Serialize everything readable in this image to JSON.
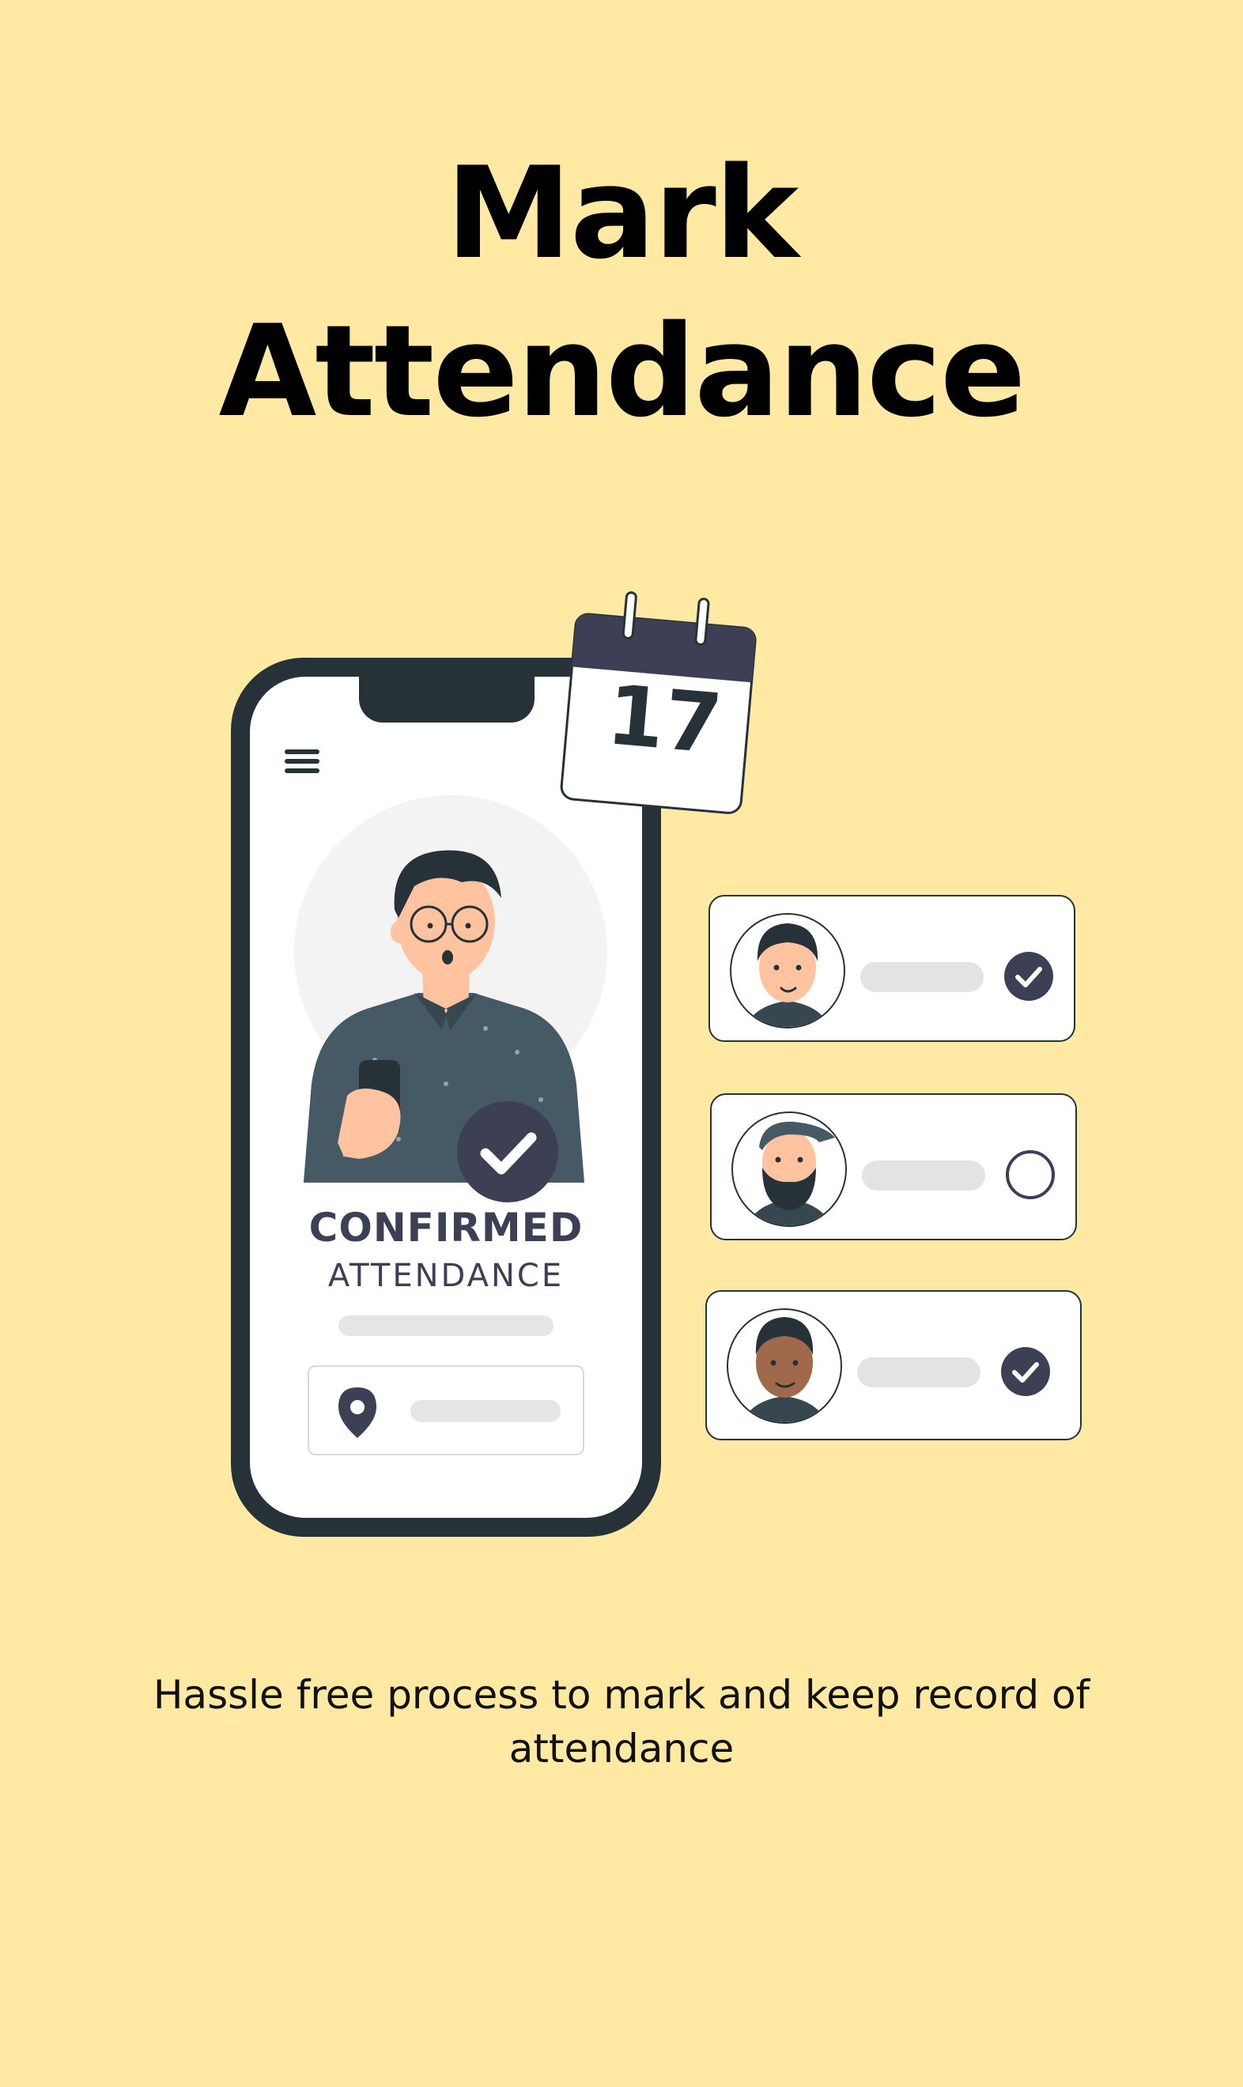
{
  "header": {
    "title_line1": "Mark",
    "title_line2": "Attendance"
  },
  "phone": {
    "status_title": "CONFIRMED",
    "status_subtitle": "ATTENDANCE",
    "icons": [
      "menu-icon",
      "check-icon",
      "location-pin-icon"
    ]
  },
  "calendar": {
    "day": "17"
  },
  "attendees": [
    {
      "status": "checked"
    },
    {
      "status": "unchecked"
    },
    {
      "status": "checked"
    }
  ],
  "footer": {
    "description": "Hassle free process to mark and keep record of attendance"
  },
  "colors": {
    "background": "#FFE9A3",
    "dark": "#263238",
    "accent": "#3D4055",
    "card": "#FFFFFF"
  }
}
